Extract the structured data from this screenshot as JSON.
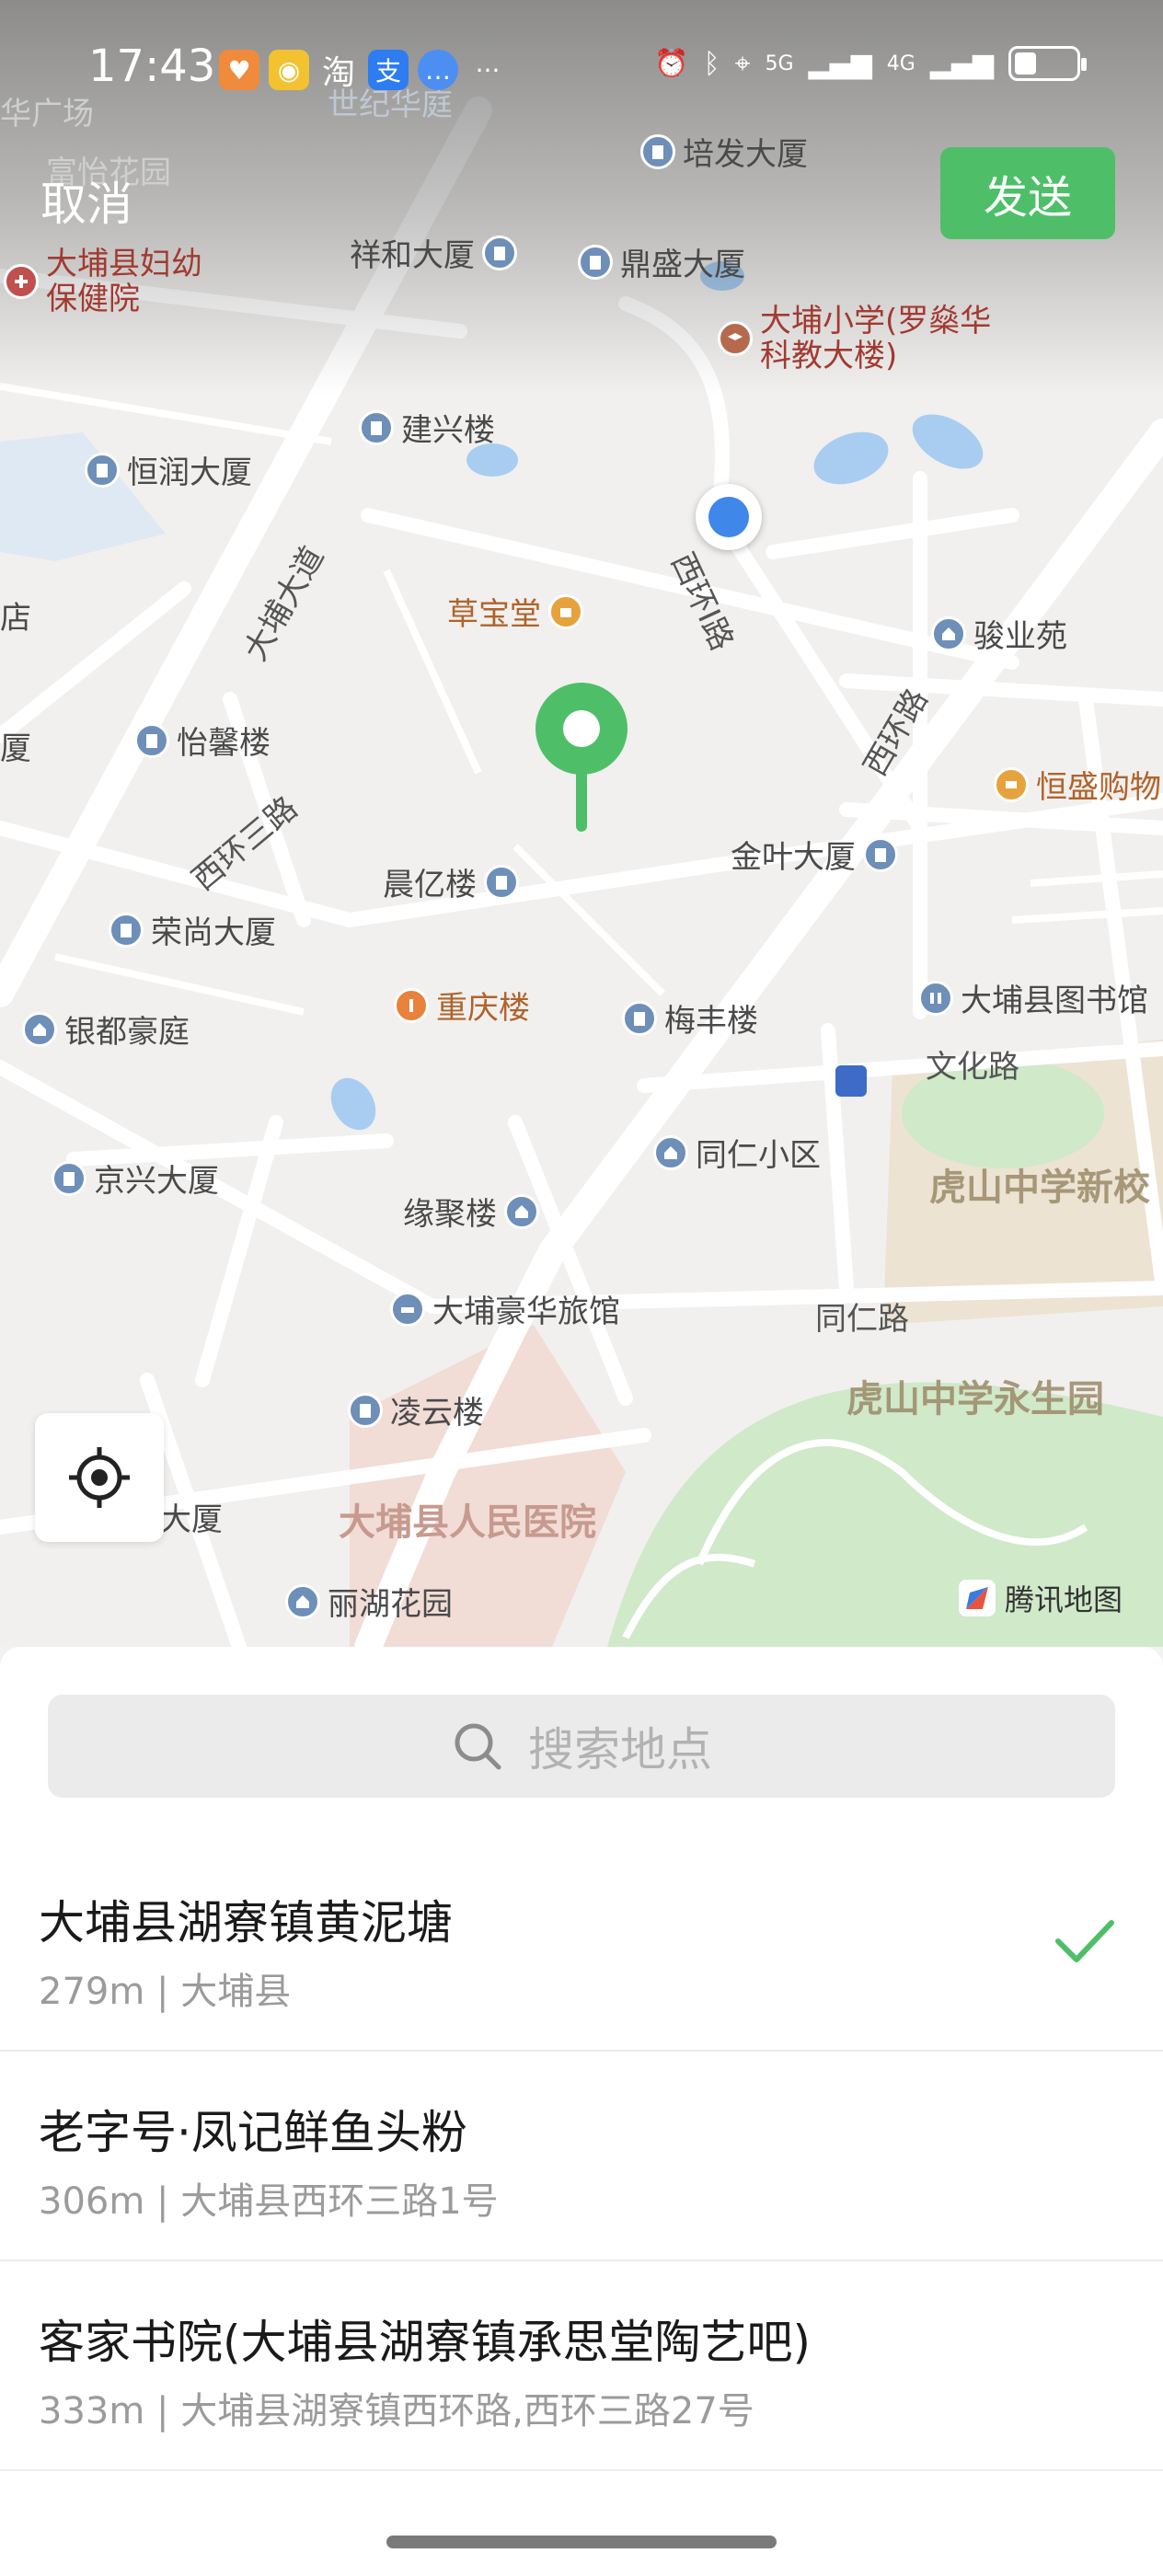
{
  "status_bar": {
    "time": "17:43",
    "app_icons": [
      "淘",
      "支"
    ],
    "more": "···",
    "network": [
      "5G",
      "4G"
    ],
    "battery_level": 0.35
  },
  "header": {
    "cancel_label": "取消",
    "send_label": "发送"
  },
  "map": {
    "pois": [
      {
        "name": "培发大厦"
      },
      {
        "name": "祥和大厦"
      },
      {
        "name": "鼎盛大厦"
      },
      {
        "name": "大埔县妇幼保健院"
      },
      {
        "name": "大埔小学(罗燊华科教大楼)"
      },
      {
        "name": "建兴楼"
      },
      {
        "name": "恒润大厦"
      },
      {
        "name": "草宝堂"
      },
      {
        "name": "骏业苑"
      },
      {
        "name": "怡馨楼"
      },
      {
        "name": "恒盛购物"
      },
      {
        "name": "金叶大厦"
      },
      {
        "name": "晨亿楼"
      },
      {
        "name": "荣尚大厦"
      },
      {
        "name": "重庆楼"
      },
      {
        "name": "梅丰楼"
      },
      {
        "name": "大埔县图书馆"
      },
      {
        "name": "银都豪庭"
      },
      {
        "name": "同仁小区"
      },
      {
        "name": "京兴大厦"
      },
      {
        "name": "缘聚楼"
      },
      {
        "name": "大埔豪华旅馆"
      },
      {
        "name": "凌云楼"
      },
      {
        "name": "丽湖花园"
      },
      {
        "name": "大厦"
      },
      {
        "name": "店"
      },
      {
        "name": "厦"
      },
      {
        "name": "华广场"
      },
      {
        "name": "富怡花园"
      },
      {
        "name": "世纪华庭"
      }
    ],
    "roads": [
      "大埔大道",
      "西环I路",
      "西环路",
      "西环三路",
      "文化路",
      "同仁路"
    ],
    "areas": [
      "虎山中学新校",
      "虎山中学永生园",
      "大埔县人民医院"
    ],
    "attribution": "腾讯地图"
  },
  "search": {
    "placeholder": "搜索地点"
  },
  "results": [
    {
      "name": "大埔县湖寮镇黄泥塘",
      "detail": "279m | 大埔县",
      "selected": true
    },
    {
      "name": "老字号·凤记鲜鱼头粉",
      "detail": "306m | 大埔县西环三路1号",
      "selected": false
    },
    {
      "name": "客家书院(大埔县湖寮镇承思堂陶艺吧)",
      "detail": "333m | 大埔县湖寮镇西环路,西环三路27号",
      "selected": false
    }
  ],
  "colors": {
    "accent_green": "#4ebf68",
    "location_blue": "#3f87e8"
  }
}
